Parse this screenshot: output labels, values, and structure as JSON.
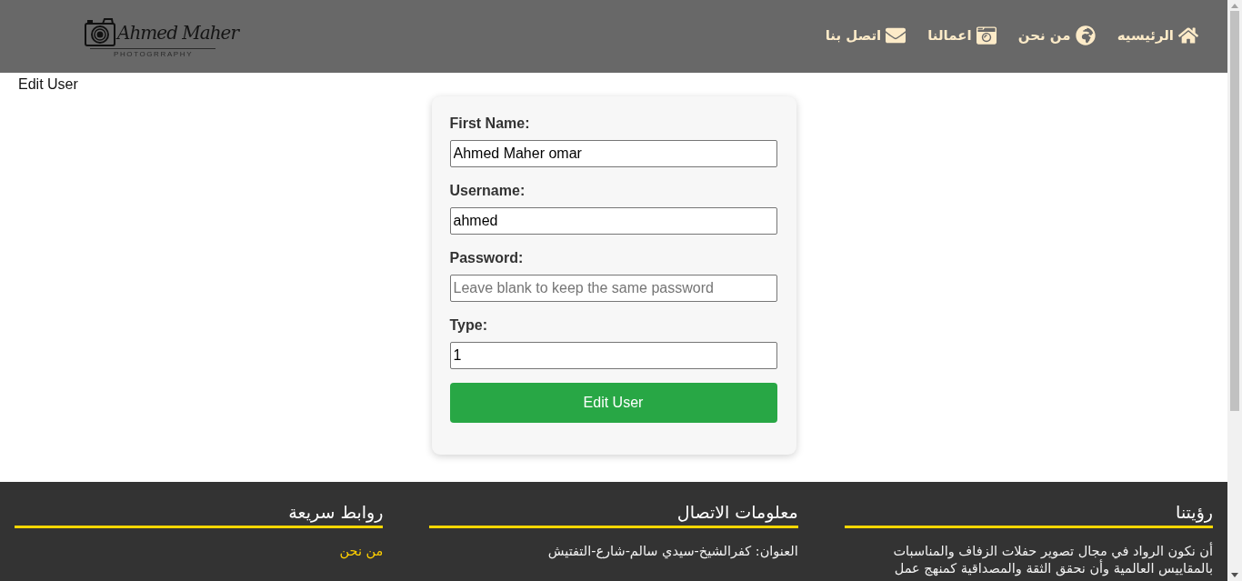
{
  "header": {
    "logo": {
      "script": "Ahmed Maher",
      "tagline": "PHOTOGRRAPHY"
    },
    "nav": [
      {
        "label": "الرئيسيه"
      },
      {
        "label": "من نحن"
      },
      {
        "label": "اعمالنا"
      },
      {
        "label": "اتصل بنا"
      }
    ]
  },
  "page_title": "Edit User",
  "form": {
    "fields": [
      {
        "label": "First Name:",
        "value": "Ahmed Maher omar"
      },
      {
        "label": "Username:",
        "value": "ahmed"
      },
      {
        "label": "Password:",
        "placeholder": "Leave blank to keep the same password"
      },
      {
        "label": "Type:",
        "value": "1"
      }
    ],
    "submit": "Edit User"
  },
  "footer": {
    "columns": [
      {
        "heading": "رؤيتنا",
        "kind": "text",
        "text": "أن نكون الرواد في مجال تصوير حفلات الزفاف والمناسبات بالمقاييس العالمية وأن نحقق الثقة والمصداقية كمنهج عمل"
      },
      {
        "heading": "معلومات الاتصال",
        "kind": "text",
        "text": "العنوان: كفرالشيخ-سيدي سالم-شارع-التفتيش"
      },
      {
        "heading": "روابط سريعة",
        "kind": "links",
        "links": [
          "من نحن"
        ]
      }
    ]
  }
}
